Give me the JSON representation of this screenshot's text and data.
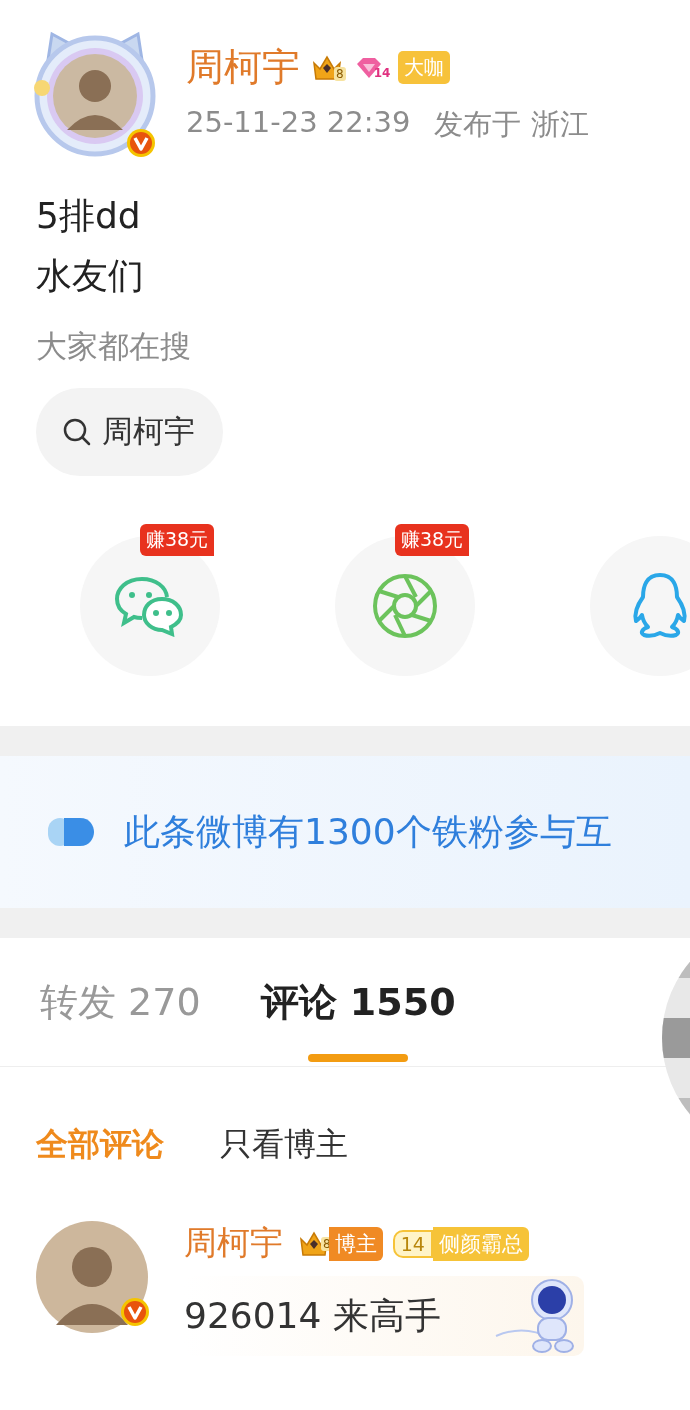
{
  "post": {
    "author": {
      "name": "周柯宇",
      "verified": true,
      "badges": [
        {
          "kind": "crown",
          "text": "8"
        },
        {
          "kind": "diamond",
          "text": "14"
        },
        {
          "kind": "label",
          "text": "大咖"
        }
      ]
    },
    "time": "25-11-23 22:39",
    "location": "发布于 浙江",
    "lines": [
      "5排dd",
      "水友们"
    ]
  },
  "trending": {
    "title": "大家都在搜",
    "chips": [
      {
        "text": "周柯宇"
      }
    ]
  },
  "share": [
    {
      "kind": "wechat",
      "reward": "赚38元"
    },
    {
      "kind": "moments",
      "reward": "赚38元"
    },
    {
      "kind": "qq"
    }
  ],
  "banner": {
    "text": "此条微博有1300个铁粉参与互"
  },
  "tabs": [
    {
      "label": "转发",
      "count": "270",
      "selected": false
    },
    {
      "label": "评论",
      "count": "1550",
      "selected": true
    }
  ],
  "filters": [
    {
      "label": "全部评论",
      "selected": true
    },
    {
      "label": "只看博主",
      "selected": false
    }
  ],
  "comments": [
    {
      "name": "周柯宇",
      "verified": true,
      "badges": [
        {
          "kind": "crown-label",
          "number": "8",
          "text": "博主"
        },
        {
          "kind": "level-label",
          "number": "14",
          "text": "侧颜霸总"
        }
      ],
      "text": "926014 来高手"
    }
  ]
}
